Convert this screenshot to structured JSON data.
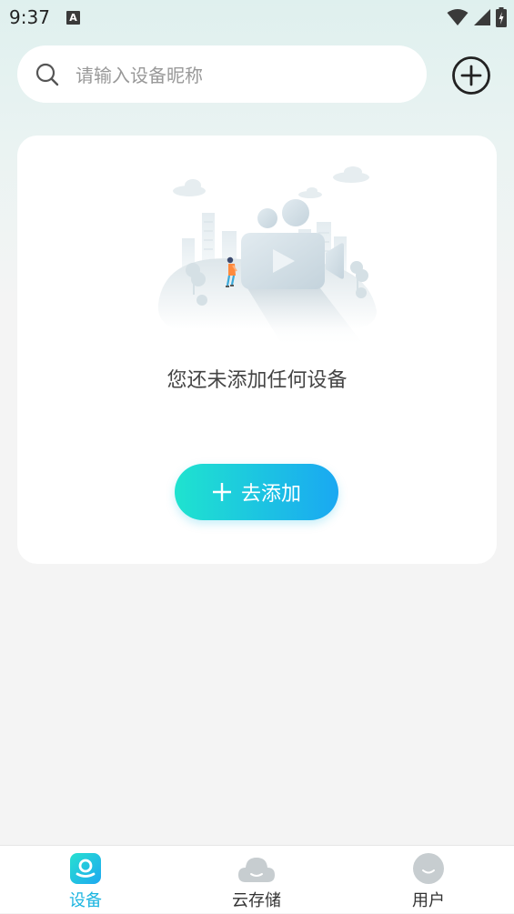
{
  "status_bar": {
    "time": "9:37",
    "notification_badge": "A"
  },
  "search": {
    "placeholder": "请输入设备昵称",
    "value": ""
  },
  "empty_state": {
    "message": "您还未添加任何设备",
    "add_button_label": "去添加"
  },
  "bottom_nav": {
    "items": [
      {
        "label": "设备",
        "icon": "device-icon",
        "active": true
      },
      {
        "label": "云存储",
        "icon": "cloud-icon",
        "active": false
      },
      {
        "label": "用户",
        "icon": "user-icon",
        "active": false
      }
    ]
  },
  "colors": {
    "accent": "#1cb5e0",
    "button_gradient_start": "#1fe3cf",
    "button_gradient_end": "#1aa8f2",
    "inactive_icon": "#c7cdd0"
  }
}
